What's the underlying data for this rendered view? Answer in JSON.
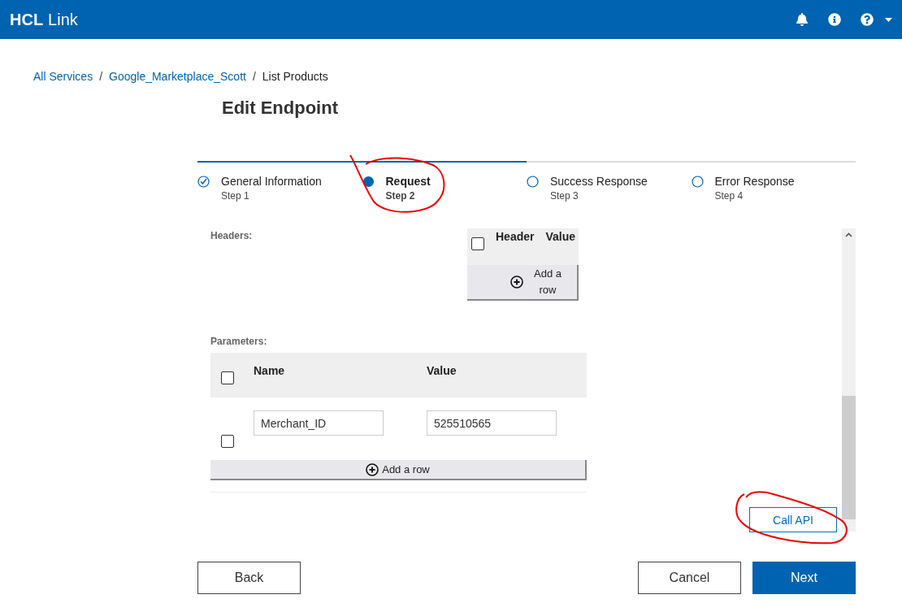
{
  "app_bar": {
    "brand_bold": "HCL",
    "brand_rest": "Link"
  },
  "breadcrumb": [
    {
      "label": "All Services",
      "link": true
    },
    {
      "label": "Google_Marketplace_Scott",
      "link": true
    },
    {
      "label": "List Products",
      "link": false
    }
  ],
  "separator": "/",
  "title": "Edit Endpoint",
  "steps": [
    {
      "label": "General Information",
      "sub": "Step 1",
      "kind": "complete",
      "selected": false
    },
    {
      "label": "Request",
      "sub": "Step 2",
      "kind": "current",
      "selected": true
    },
    {
      "label": "Success Response",
      "sub": "Step 3",
      "kind": "pending",
      "selected": false
    },
    {
      "label": "Error Response",
      "sub": "Step 4",
      "kind": "pending",
      "selected": false
    }
  ],
  "headers": {
    "label": "Headers:",
    "columns": [
      "Header",
      "Value"
    ],
    "select_all_checked": false,
    "add_row": "Add a row"
  },
  "parameters": {
    "label": "Parameters:",
    "columns": [
      "Name",
      "Value"
    ],
    "select_all_checked": false,
    "rows": [
      {
        "name": "Merchant_ID",
        "value": "525510565",
        "checked": false
      }
    ],
    "add_row": "Add a row"
  },
  "call_api": "Call API",
  "footer": {
    "back": "Back",
    "cancel": "Cancel",
    "next": "Next"
  }
}
